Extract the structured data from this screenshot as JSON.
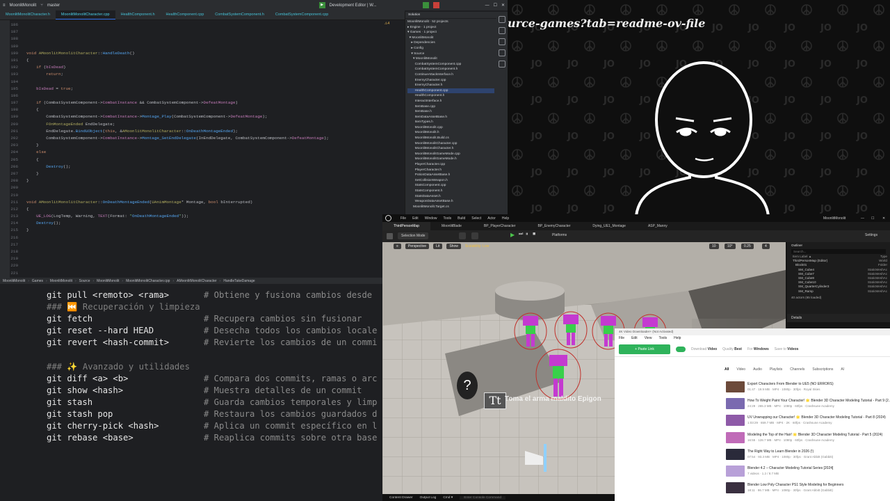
{
  "ide": {
    "project": "MoonlitMonolit",
    "branch": "master",
    "window_title": "Development Editor | W...",
    "tabs": [
      "MoonlitMonolitCharacter.h",
      "MoonlitMonolitCharacter.cpp",
      "HealthComponent.h",
      "HealthComponent.cpp",
      "CombatSystemComponent.h",
      "CombatSystemComponent.cpp"
    ],
    "column_indicator": "⚠4",
    "code_lines": [
      {
        "n": "186",
        "t": ""
      },
      {
        "n": "187",
        "t": ""
      },
      {
        "n": "188",
        "t": ""
      },
      {
        "n": "189",
        "t": ""
      },
      {
        "n": "190",
        "t": "void AMoonlitMonolitCharacter::HandleDeath()"
      },
      {
        "n": "191",
        "t": "{"
      },
      {
        "n": "192",
        "t": "    if (bIsDead)"
      },
      {
        "n": "193",
        "t": "        return;"
      },
      {
        "n": "194",
        "t": ""
      },
      {
        "n": "195",
        "t": "    bIsDead = true;"
      },
      {
        "n": "196",
        "t": ""
      },
      {
        "n": "197",
        "t": "    if (CombatSystemComponent->CombatInstance && CombatSystemComponent->DefeatMontage)"
      },
      {
        "n": "198",
        "t": "    {"
      },
      {
        "n": "199",
        "t": "        CombatSystemComponent->CombatInstance->Montage_Play(CombatSystemComponent->DefeatMontage);"
      },
      {
        "n": "200",
        "t": "        FOnMontageEnded EndDelegate;"
      },
      {
        "n": "201",
        "t": "        EndDelegate.BindUObject(this, &AMoonlitMonolitCharacter::OnDeathMontageEnded);"
      },
      {
        "n": "202",
        "t": "        CombatSystemComponent->CombatInstance->Montage_SetEndDelegate(InEndDelegate, CombatSystemComponent->DefeatMontage);"
      },
      {
        "n": "203",
        "t": "    }"
      },
      {
        "n": "204",
        "t": "    else"
      },
      {
        "n": "205",
        "t": "    {"
      },
      {
        "n": "206",
        "t": "        Destroy();"
      },
      {
        "n": "207",
        "t": "    }"
      },
      {
        "n": "208",
        "t": "}"
      },
      {
        "n": "209",
        "t": ""
      },
      {
        "n": "210",
        "t": ""
      },
      {
        "n": "211",
        "t": "void AMoonlitMonolitCharacter::OnDeathMontageEnded(UAnimMontage* Montage, bool bInterrupted)"
      },
      {
        "n": "212",
        "t": "{"
      },
      {
        "n": "213",
        "t": "    UE_LOG(LogTemp, Warning, TEXT(Format: \"OnDeathMontageEnded\"));"
      },
      {
        "n": "214",
        "t": "    Destroy();"
      },
      {
        "n": "215",
        "t": "}"
      },
      {
        "n": "216",
        "t": ""
      },
      {
        "n": "217",
        "t": ""
      },
      {
        "n": "218",
        "t": ""
      },
      {
        "n": "219",
        "t": ""
      },
      {
        "n": "220",
        "t": ""
      },
      {
        "n": "221",
        "t": ""
      }
    ],
    "solution_title": "Solution",
    "solution_count": "MoonlitMonolit · 52 projects",
    "solution_items": [
      "▸ Engine · 1 project",
      "▾ Games · 1 project",
      "  ▾ MoonlitMonolit",
      "    ▸ Dependencies",
      "    ▸ Config",
      "    ▾ Source",
      "      ▾ MoonlitMonolit",
      "        CombatSystemComponent.cpp",
      "        CombatSystemComponent.h",
      "        ContinueAttackInterface.h",
      "        EnemyCharacter.cpp",
      "        EnemyCharacter.h",
      "        HealthComponent.cpp",
      "        HealthComponent.h",
      "        InteractInterface.h",
      "        ItemBase.cpp",
      "        ItemBase.h",
      "        ItemDataAssetBase.h",
      "        ItemTypes.h",
      "        MoonlitMonolit.cpp",
      "        MoonlitMonolit.h",
      "        MoonlitMonolit.Build.cs",
      "        MoonlitMonolitCharacter.cpp",
      "        MoonlitMonolitCharacter.h",
      "        MoonlitMonolitGameMode.cpp",
      "        MoonlitMonolitGameMode.h",
      "        PlayerCharacter.cpp",
      "        PlayerCharacter.h",
      "        PotionDataAssetBase.h",
      "        SetCollisionWeapon.h",
      "        StatsComponent.cpp",
      "        StatsComponent.h",
      "        StatsDataAsset.h",
      "        WeaponDataAssetBase.h",
      "      MoonlitMonolit.Target.cs"
    ],
    "selected_solution_item": 12,
    "status_path": [
      "MoonlitMonolit",
      "Games",
      "MoonlitMonolit",
      "Source",
      "MoonlitMonolit",
      "MoonlitMonolitCharacter.cpp",
      "AMoonlitMonolitCharacter",
      "HandleTakeDamage"
    ]
  },
  "terminal": {
    "lines": [
      {
        "cmd": "git pull <remoto> <rama>",
        "comment": "# Obtiene y fusiona cambios desde"
      },
      {
        "head": "### ⏮️ Recuperación y limpieza"
      },
      {
        "cmd": "git fetch",
        "comment": "# Recupera cambios sin fusionar"
      },
      {
        "cmd": "git reset --hard HEAD",
        "comment": "# Desecha todos los cambios locale"
      },
      {
        "cmd": "git revert <hash-commit>",
        "comment": "# Revierte los cambios de un commi"
      },
      {
        "head": ""
      },
      {
        "head": "### ✨ Avanzado y utilidades"
      },
      {
        "cmd": "git diff <a> <b>",
        "comment": "# Compara dos commits, ramas o arc"
      },
      {
        "cmd": "git show <hash>",
        "comment": "# Muestra detalles de un commit"
      },
      {
        "cmd": "git stash",
        "comment": "# Guarda cambios temporales y limp"
      },
      {
        "cmd": "git stash pop",
        "comment": "# Restaura los cambios guardados d"
      },
      {
        "cmd": "git cherry-pick <hash>",
        "comment": "# Aplica un commit específico en l"
      },
      {
        "cmd": "git rebase <base>",
        "comment": "# Reaplica commits sobre otra base"
      }
    ]
  },
  "stream": {
    "url_fragment": "urce-games?tab=readme-ov-file",
    "avatar_mark": "J O"
  },
  "ue": {
    "window_title": "MoonlitMonolit",
    "menu": [
      "File",
      "Edit",
      "Window",
      "Tools",
      "Build",
      "Select",
      "Actor",
      "Help"
    ],
    "tabs": [
      "ThirdPersonMap",
      "MoonlitBlade",
      "BP_PlayerCharacter",
      "BP_EnemyCharacter",
      "Dying_UE1_Montage",
      "ASP_Manny"
    ],
    "selection_mode": "Selection Mode",
    "platforms": "Platforms",
    "settings": "Settings",
    "viewport_buttons": [
      "Perspective",
      "Lit",
      "Show"
    ],
    "scalability": "Scalability: Low",
    "grid_values": [
      "10",
      "10°",
      "0.25",
      "4"
    ],
    "subtitle_text": "Toma el arma maldito Epigon",
    "outliner_title": "Outliner",
    "outliner_search": "Search...",
    "outliner_cols": [
      "Item Label ▲",
      "Type"
    ],
    "outliner_rows": [
      {
        "label": "ThirdPersonMap (Editor)",
        "type": "World"
      },
      {
        "label": "Block01",
        "type": "Folder"
      },
      {
        "label": "SM_Cube4",
        "type": "StaticMeshAc"
      },
      {
        "label": "SM_Cube7",
        "type": "StaticMeshAc"
      },
      {
        "label": "SM_Cube8",
        "type": "StaticMeshAc"
      },
      {
        "label": "SM_Cube10",
        "type": "StaticMeshAc"
      },
      {
        "label": "SM_QuarterCylinder3",
        "type": "StaticMeshAc"
      },
      {
        "label": "SM_Ramp",
        "type": "StaticMeshAc"
      }
    ],
    "actor_count": "40 actors (65 loaded)",
    "details_title": "Details",
    "bottom": [
      "Content Drawer",
      "Output Log",
      "Cmd ▾",
      "Enter Console Command"
    ]
  },
  "downloader": {
    "title": "4K Video Downloader+ (Not Activated)",
    "menu": [
      "File",
      "Edit",
      "View",
      "Tools",
      "Help"
    ],
    "paste_button": "Paste Link",
    "download_label": "Download",
    "download_value": "Video",
    "quality_label": "Quality",
    "quality_value": "Best",
    "for_label": "For",
    "for_value": "Windows",
    "save_label": "Save to",
    "save_value": "Videos",
    "filters": [
      "All",
      "Video",
      "Audio",
      "Playlists",
      "Channels",
      "Subscriptions",
      "AI"
    ],
    "videos": [
      {
        "title": "Export Characters From Blender to UE5 (NO ERRORS)",
        "meta": "01:47 · 19.9 MB · MP4 · 1080p · 30fps · Royal Skies",
        "color": "#6c4a3a"
      },
      {
        "title": "How To Weight Paint Your Character! 🌟 Blender 3D Character Modeling Tutorial - Part 9 (2...",
        "meta": "24:29 · 265.3 MB · MP4 · 1080p · 60fps · Crashsune Academy",
        "color": "#7a6ab0"
      },
      {
        "title": "UV Unwrapping our Character! 🌟 Blender 3D Character Modeling Tutorial - Part 8 (2024)",
        "meta": "1:03:29 · 659.7 MB · MP4 · 2K · 60fps · Crashsune Academy",
        "color": "#8e5aa8"
      },
      {
        "title": "Modeling the Top of the Hair! 🌟 Blender 3D Character Modeling Tutorial - Part 5 (2024)",
        "meta": "16:55 · 128.7 MB · MP4 · 1080p · 60fps · Crashsune Academy",
        "color": "#c06bb8"
      },
      {
        "title": "The Right Way to Learn Blender in 2026 (!)",
        "meta": "07:54 · 93.3 MB · MP4 · 1080p · 30fps · Grant Abbitt (Gabbitt)",
        "color": "#2a2a3a"
      },
      {
        "title": "Blender 4.2 – Character Modeling Tutorial Series [2024]",
        "meta": "7 videos · 1.2 / 8.7 MB",
        "color": "#b8a0d8"
      },
      {
        "title": "Blender Low Poly Character PS1 Style Modeling for Beginners",
        "meta": "18:11 · 86.7 MB · MP4 · 1080p · 30fps · Grant Abbitt (Gabbitt)",
        "color": "#3a3040"
      }
    ]
  }
}
